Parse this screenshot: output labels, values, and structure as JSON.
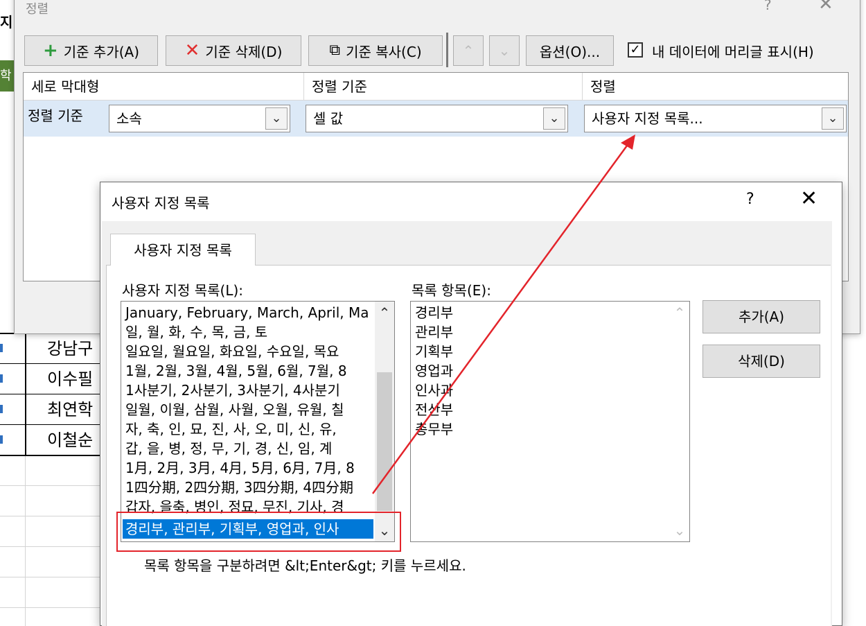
{
  "spreadsheet": {
    "col_header_fragment": "지",
    "green_cell_fragment": "학",
    "name_cells": [
      "강남구",
      "이수필",
      "최연학",
      "이철순"
    ]
  },
  "sort_dialog": {
    "title": "정렬",
    "help": "?",
    "close": "✕",
    "toolbar": {
      "add_level": "기준 추가(A)",
      "delete_level": "기준 삭제(D)",
      "copy_level": "기준 복사(C)",
      "move_up": "⌃",
      "move_down": "⌄",
      "options": "옵션(O)...",
      "has_headers_checked": true,
      "has_headers_label": "내 데이터에 머리글 표시(H)"
    },
    "columns": {
      "column_header": "세로 막대형",
      "sort_on_header": "정렬 기준",
      "order_header": "정렬"
    },
    "level_row": {
      "label": "정렬 기준",
      "column_value": "소속",
      "sort_on_value": "셀 값",
      "order_value": "사용자 지정 목록..."
    }
  },
  "custom_list_dialog": {
    "title": "사용자 지정 목록",
    "help": "?",
    "close": "✕",
    "tab": "사용자 지정 목록",
    "custom_lists_label": "사용자 지정 목록(L):",
    "list_entries_label": "목록 항목(E):",
    "custom_lists": [
      "January, February, March, April, Ma",
      "일, 월, 화, 수, 목, 금, 토",
      "일요일, 월요일, 화요일, 수요일, 목요",
      "1월, 2월, 3월, 4월, 5월, 6월, 7월, 8",
      "1사분기, 2사분기, 3사분기, 4사분기",
      "일월, 이월, 삼월, 사월, 오월, 유월, 칠",
      "자, 축, 인, 묘, 진, 사, 오, 미, 신, 유,",
      "갑, 을, 병, 정, 무, 기, 경, 신, 임, 계",
      "1月, 2月, 3月, 4月, 5月, 6月, 7月, 8",
      "1四分期, 2四分期, 3四分期, 4四分期",
      "갑자, 을축, 병인, 정묘, 무진, 기사, 경",
      "경리부, 관리부, 기획부, 영업과, 인사"
    ],
    "selected_index": 11,
    "list_entries": [
      "경리부",
      "관리부",
      "기획부",
      "영업과",
      "인사과",
      "전산부",
      "총무부"
    ],
    "add_button": "추가(A)",
    "delete_button": "삭제(D)",
    "hint": "목록 항목을 구분하려면 &lt;Enter&gt; 키를 누르세요."
  },
  "colors": {
    "annotation_red": "#e3242b",
    "selection_blue": "#0078d7",
    "row_band": "#dce9f7",
    "excel_green": "#548235"
  }
}
